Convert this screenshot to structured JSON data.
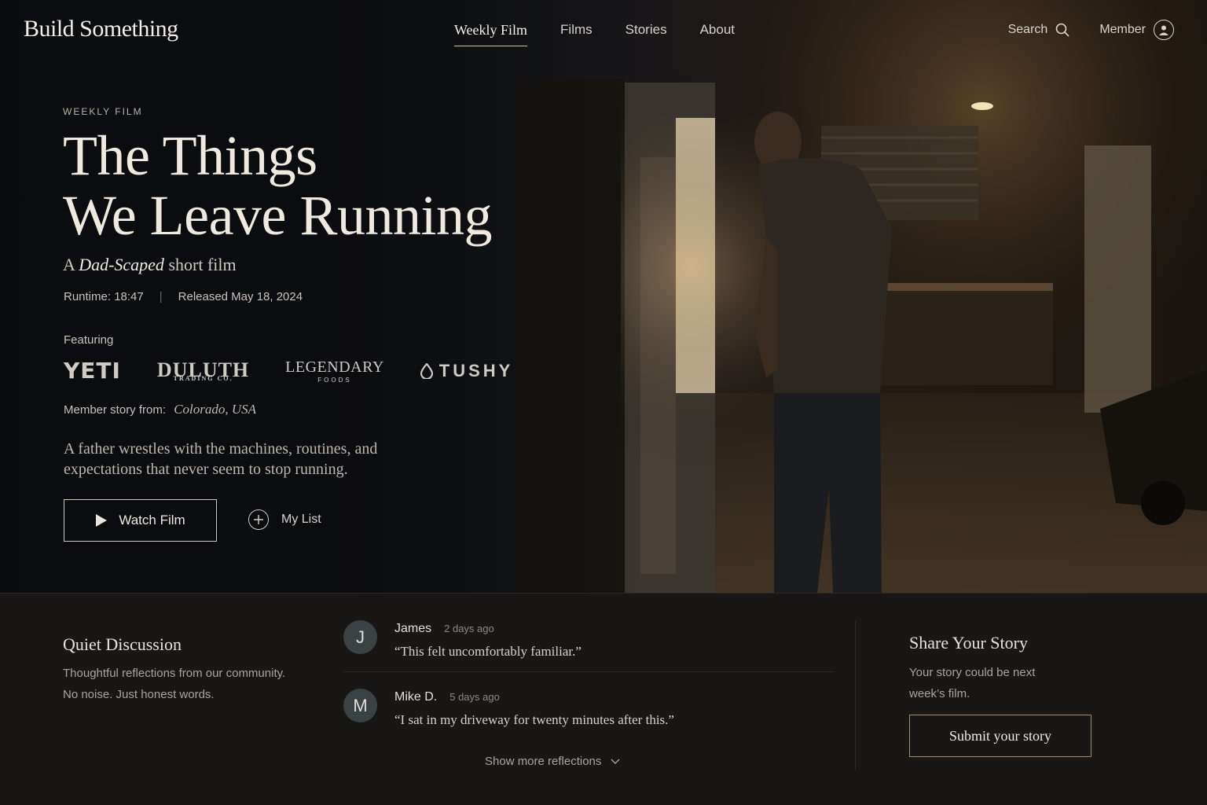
{
  "nav": {
    "logo": "Build Something",
    "links": [
      "Weekly Film",
      "Films",
      "Stories",
      "About"
    ],
    "search_label": "Search",
    "member_label": "Member"
  },
  "hero": {
    "eyebrow": "WEEKLY FILM",
    "title_line1": "The Things",
    "title_line2": "We Leave Running",
    "subtitle_prefix": "A",
    "subtitle_em": "Dad-Scaped",
    "subtitle_suffix": "short film",
    "runtime": "Runtime: 18:47",
    "released": "Released May 18, 2024",
    "featuring_label": "Featuring",
    "brands": [
      "YETI",
      "DULUTH",
      "LEGENDARY",
      "TUSHY"
    ],
    "duluth_sub": "TRADING CO.",
    "legendary_sub": "FOODS",
    "member_story_label": "Member story from:",
    "member_story_location": "Colorado, USA",
    "description": "A father wrestles with the machines, routines, and expectations that never seem to stop running.",
    "watch_label": "Watch Film",
    "mylist_label": "My List"
  },
  "discussion": {
    "title": "Quiet Discussion",
    "subtitle_line1": "Thoughtful reflections from our community.",
    "subtitle_line2": "No noise. Just honest words.",
    "comments": [
      {
        "initial": "J",
        "name": "James",
        "time": "2 days ago",
        "text": "“This felt uncomfortably familiar.”"
      },
      {
        "initial": "M",
        "name": "Mike D.",
        "time": "5 days ago",
        "text": "“I sat in my driveway for twenty minutes after this.”"
      }
    ],
    "show_more": "Show more reflections"
  },
  "share": {
    "title": "Share Your Story",
    "subtitle_line1": "Your story could be next",
    "subtitle_line2": "week’s film.",
    "button": "Submit your story"
  },
  "colors": {
    "accent_border": "#a08a68",
    "background": "#161514"
  }
}
